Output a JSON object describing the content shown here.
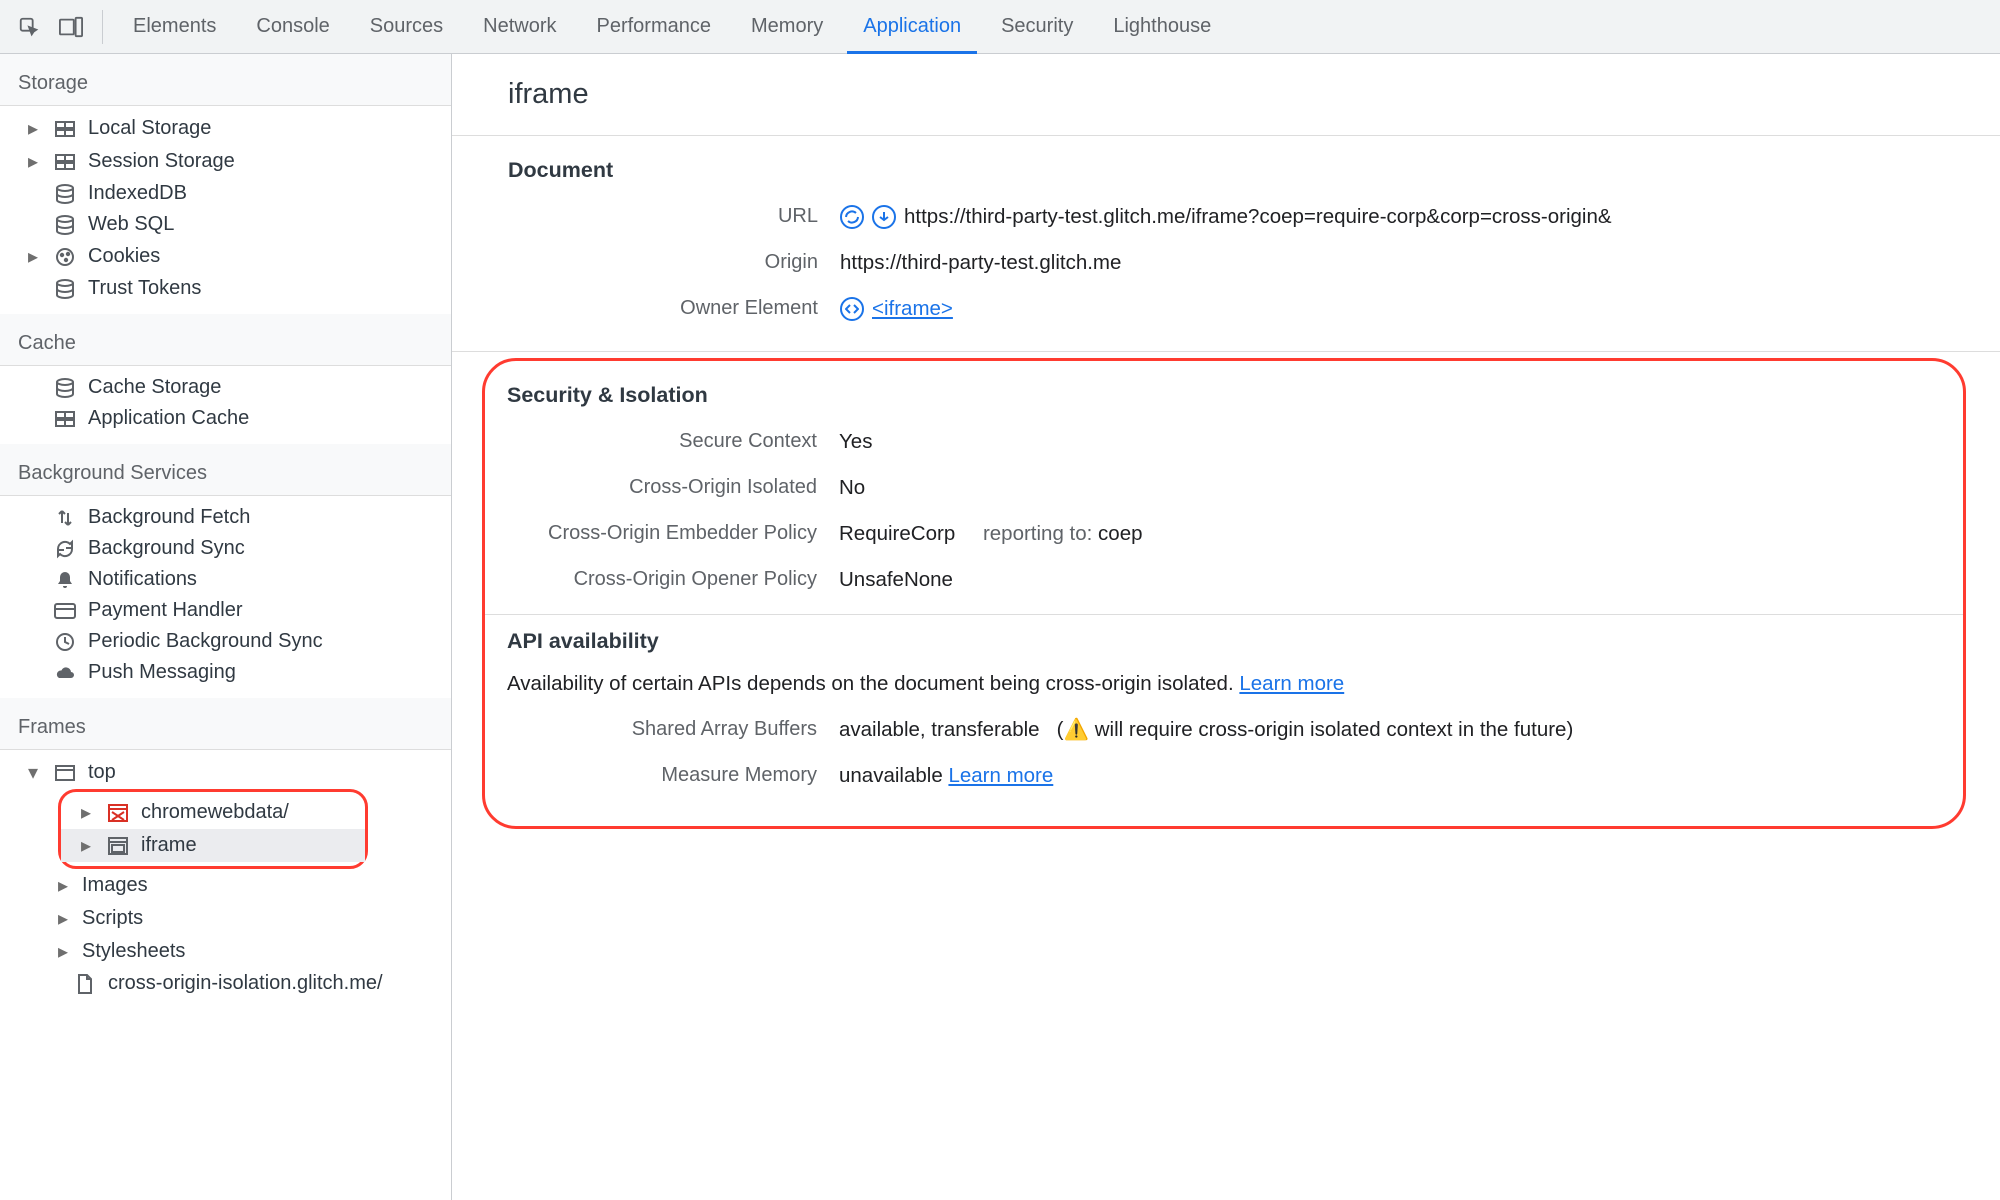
{
  "topbar": {
    "tabs": [
      "Elements",
      "Console",
      "Sources",
      "Network",
      "Performance",
      "Memory",
      "Application",
      "Security",
      "Lighthouse"
    ],
    "active_index": 6
  },
  "sidebar": {
    "sections": {
      "storage": {
        "title": "Storage",
        "items": [
          "Local Storage",
          "Session Storage",
          "IndexedDB",
          "Web SQL",
          "Cookies",
          "Trust Tokens"
        ]
      },
      "cache": {
        "title": "Cache",
        "items": [
          "Cache Storage",
          "Application Cache"
        ]
      },
      "bg": {
        "title": "Background Services",
        "items": [
          "Background Fetch",
          "Background Sync",
          "Notifications",
          "Payment Handler",
          "Periodic Background Sync",
          "Push Messaging"
        ]
      },
      "frames": {
        "title": "Frames",
        "top": "top",
        "chromewebdata": "chromewebdata/",
        "iframe": "iframe",
        "images": "Images",
        "scripts": "Scripts",
        "stylesheets": "Stylesheets",
        "doc": "cross-origin-isolation.glitch.me/"
      }
    }
  },
  "detail": {
    "title": "iframe",
    "document": {
      "heading": "Document",
      "url_label": "URL",
      "url_value": "https://third-party-test.glitch.me/iframe?coep=require-corp&corp=cross-origin&",
      "origin_label": "Origin",
      "origin_value": "https://third-party-test.glitch.me",
      "owner_label": "Owner Element",
      "owner_link": "<iframe>"
    },
    "security": {
      "heading": "Security & Isolation",
      "secure_label": "Secure Context",
      "secure_value": "Yes",
      "coi_label": "Cross-Origin Isolated",
      "coi_value": "No",
      "coep_label": "Cross-Origin Embedder Policy",
      "coep_value": "RequireCorp",
      "coep_reporting_label": "reporting to:",
      "coep_reporting_value": "coep",
      "coop_label": "Cross-Origin Opener Policy",
      "coop_value": "UnsafeNone"
    },
    "api": {
      "heading": "API availability",
      "desc": "Availability of certain APIs depends on the document being cross-origin isolated.",
      "learn_more": "Learn more",
      "sab_label": "Shared Array Buffers",
      "sab_value": "available, transferable",
      "sab_note_open": "(",
      "sab_note": " will require cross-origin isolated context in the future)",
      "mm_label": "Measure Memory",
      "mm_value": "unavailable",
      "mm_learn_more": "Learn more"
    }
  }
}
